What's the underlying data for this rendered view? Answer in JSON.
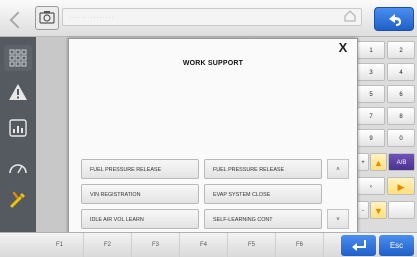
{
  "topbar": {
    "path_text": "· · · · · · · · · · · · · · ·"
  },
  "dialog": {
    "close_label": "X",
    "title": "WORK SUPPORT",
    "items": [
      "FUEL PRESSURE RELEASE",
      "FUEL PRESSURE RELEASE",
      "VIN REGISTRATION",
      "EVAP SYSTEM CLOSE",
      "IDLE AIR VOL LEARN",
      "SELF-LEARNING CONT"
    ],
    "scroll_up": "˄",
    "scroll_down": "˅"
  },
  "keypad": {
    "keys": [
      "1",
      "2",
      "3",
      "4",
      "5",
      "6",
      "7",
      "8",
      "9",
      "0",
      "+",
      "▲",
      "‹",
      "▶",
      "-",
      "▼"
    ],
    "ab_label": "A/B"
  },
  "fbar": {
    "keys": [
      "F1",
      "F2",
      "F3",
      "F4",
      "F5",
      "F6"
    ],
    "esc_label": "Esc"
  }
}
